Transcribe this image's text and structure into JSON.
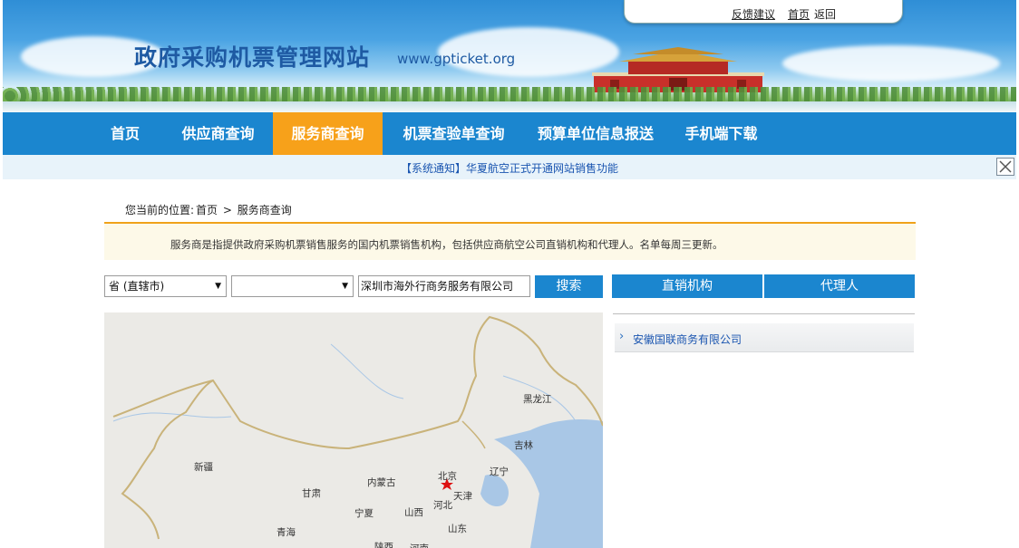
{
  "header": {
    "title": "政府采购机票管理网站",
    "url": "www.gpticket.org",
    "top_links": [
      "反馈建议",
      "首页",
      "返回"
    ]
  },
  "nav": {
    "items": [
      "首页",
      "供应商查询",
      "服务商查询",
      "机票查验单查询",
      "预算单位信息报送",
      "手机端下载"
    ],
    "active_index": 2
  },
  "notice": {
    "text": "【系统通知】华夏航空正式开通网站销售功能"
  },
  "breadcrumb": {
    "prefix": "您当前的位置:",
    "home": "首页",
    "separator": ">",
    "current": "服务商查询"
  },
  "intro": {
    "text": "服务商是指提供政府采购机票销售服务的国内机票销售机构，包括供应商航空公司直销机构和代理人。名单每周三更新。"
  },
  "search": {
    "province_value": "省 (直辖市)",
    "city_value": "",
    "keyword_value": "深圳市海外行商务服务有限公司",
    "button_label": "搜索"
  },
  "tabs": {
    "direct": "直销机构",
    "agent": "代理人"
  },
  "results": [
    {
      "name": "安徽国联商务有限公司"
    }
  ],
  "map": {
    "labels": [
      "黑龙江",
      "吉林",
      "辽宁",
      "新疆",
      "内蒙古",
      "北京",
      "天津",
      "甘肃",
      "河北",
      "宁夏",
      "山西",
      "山东",
      "青海",
      "陕西",
      "河南"
    ]
  },
  "colors": {
    "nav_bg": "#1b86cf",
    "nav_active": "#f7a11a",
    "link_blue": "#1a55b0"
  }
}
